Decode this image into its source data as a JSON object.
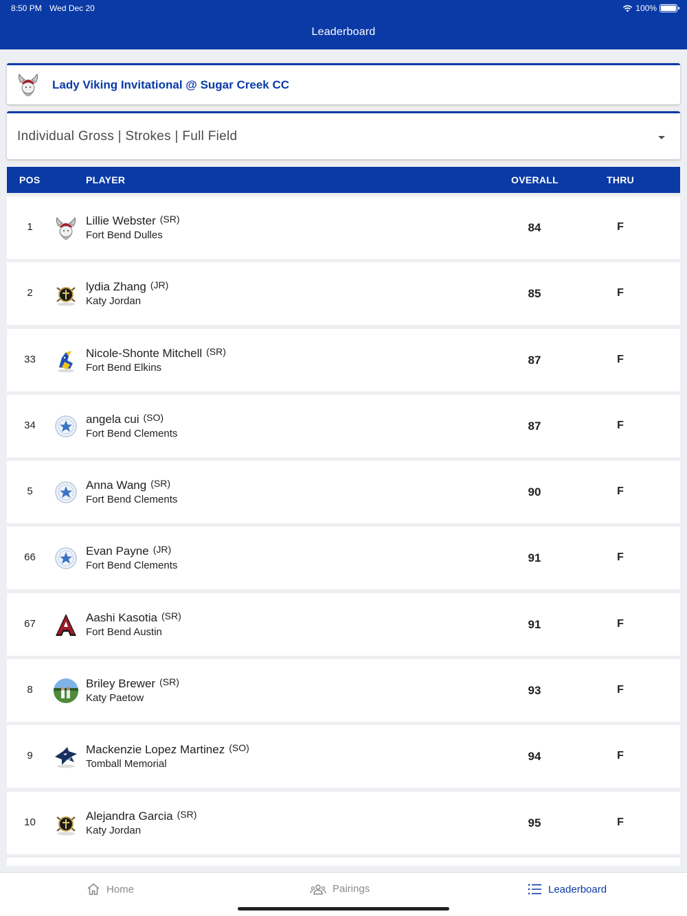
{
  "status_bar": {
    "time": "8:50 PM",
    "date": "Wed Dec 20",
    "battery": "100%"
  },
  "header": {
    "title": "Leaderboard"
  },
  "event": {
    "title": "Lady Viking Invitational @ Sugar Creek CC",
    "logo_icon": "viking-logo-icon"
  },
  "filter": {
    "label": "Individual Gross | Strokes | Full Field"
  },
  "table": {
    "headers": {
      "pos": "POS",
      "player": "PLAYER",
      "overall": "OVERALL",
      "thru": "THRU"
    },
    "rows": [
      {
        "pos": "1",
        "name": "Lillie Webster",
        "year": "(SR)",
        "school": "Fort Bend Dulles",
        "overall": "84",
        "thru": "F",
        "logo": "viking-logo-icon"
      },
      {
        "pos": "2",
        "name": "lydia Zhang",
        "year": "(JR)",
        "school": "Katy Jordan",
        "overall": "85",
        "thru": "F",
        "logo": "warrior-logo-icon"
      },
      {
        "pos": "33",
        "name": "Nicole-Shonte Mitchell",
        "year": "(SR)",
        "school": "Fort Bend Elkins",
        "overall": "87",
        "thru": "F",
        "logo": "knight-logo-icon"
      },
      {
        "pos": "34",
        "name": "angela cui",
        "year": "(SO)",
        "school": "Fort Bend Clements",
        "overall": "87",
        "thru": "F",
        "logo": "ranger-logo-icon"
      },
      {
        "pos": "5",
        "name": "Anna Wang",
        "year": "(SR)",
        "school": "Fort Bend Clements",
        "overall": "90",
        "thru": "F",
        "logo": "ranger-logo-icon"
      },
      {
        "pos": "66",
        "name": "Evan Payne",
        "year": "(JR)",
        "school": "Fort Bend Clements",
        "overall": "91",
        "thru": "F",
        "logo": "ranger-logo-icon"
      },
      {
        "pos": "67",
        "name": "Aashi Kasotia",
        "year": "(SR)",
        "school": "Fort Bend Austin",
        "overall": "91",
        "thru": "F",
        "logo": "letter-a-logo-icon"
      },
      {
        "pos": "8",
        "name": "Briley Brewer",
        "year": "(SR)",
        "school": "Katy Paetow",
        "overall": "93",
        "thru": "F",
        "logo": "photo-avatar-icon"
      },
      {
        "pos": "9",
        "name": "Mackenzie Lopez Martinez",
        "year": "(SO)",
        "school": "Tomball Memorial",
        "overall": "94",
        "thru": "F",
        "logo": "wildcat-logo-icon"
      },
      {
        "pos": "10",
        "name": "Alejandra Garcia",
        "year": "(SR)",
        "school": "Katy Jordan",
        "overall": "95",
        "thru": "F",
        "logo": "warrior-logo-icon"
      }
    ]
  },
  "tabbar": {
    "home": "Home",
    "pairings": "Pairings",
    "leaderboard": "Leaderboard"
  },
  "colors": {
    "brand": "#0a3aa6",
    "row_bg": "#ffffff",
    "page_bg": "#eeeff2"
  }
}
